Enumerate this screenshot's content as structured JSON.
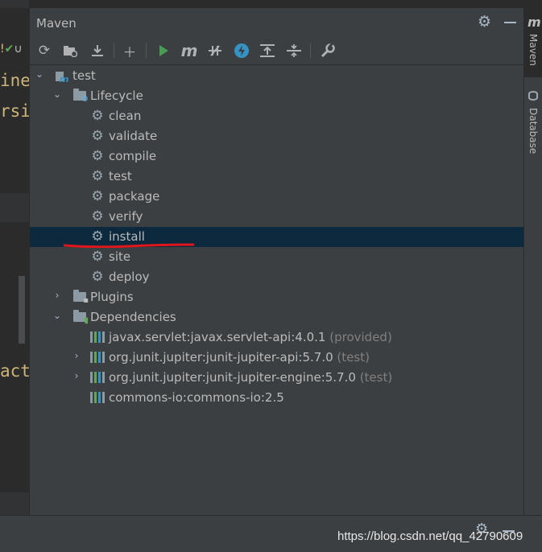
{
  "colors": {
    "panel_bg": "#3c3f41",
    "selected_row": "#0d293e",
    "run_green": "#499c54",
    "offline_blue": "#3592c4",
    "annotation_red": "#e0161b",
    "scope_gray": "#808080"
  },
  "editor": {
    "fragments": [
      "ine",
      "rsi",
      "act"
    ]
  },
  "maven_panel": {
    "title": "Maven",
    "header_icons": [
      "gear-icon",
      "minimize-icon"
    ],
    "toolbar_icons": [
      "reload-icon",
      "generate-sources-icon",
      "download-icon",
      "add-icon",
      "run-icon",
      "execute-goal-icon",
      "toggle-offline-icon",
      "skip-tests-icon",
      "show-dependencies-icon",
      "collapse-all-icon",
      "settings-wrench-icon"
    ],
    "tree": {
      "project": "test",
      "lifecycle": {
        "label": "Lifecycle",
        "goals": [
          "clean",
          "validate",
          "compile",
          "test",
          "package",
          "verify",
          "install",
          "site",
          "deploy"
        ],
        "selected": "install"
      },
      "plugins": {
        "label": "Plugins"
      },
      "dependencies": {
        "label": "Dependencies",
        "items": [
          {
            "name": "javax.servlet:javax.servlet-api:4.0.1",
            "scope": "(provided)"
          },
          {
            "name": "org.junit.jupiter:junit-jupiter-api:5.7.0",
            "scope": "(test)"
          },
          {
            "name": "org.junit.jupiter:junit-jupiter-engine:5.7.0",
            "scope": "(test)"
          },
          {
            "name": "commons-io:commons-io:2.5",
            "scope": ""
          }
        ]
      }
    }
  },
  "right_sidebar": {
    "tabs": [
      "Maven",
      "Database"
    ]
  },
  "watermark": "https://blog.csdn.net/qq_42790609"
}
